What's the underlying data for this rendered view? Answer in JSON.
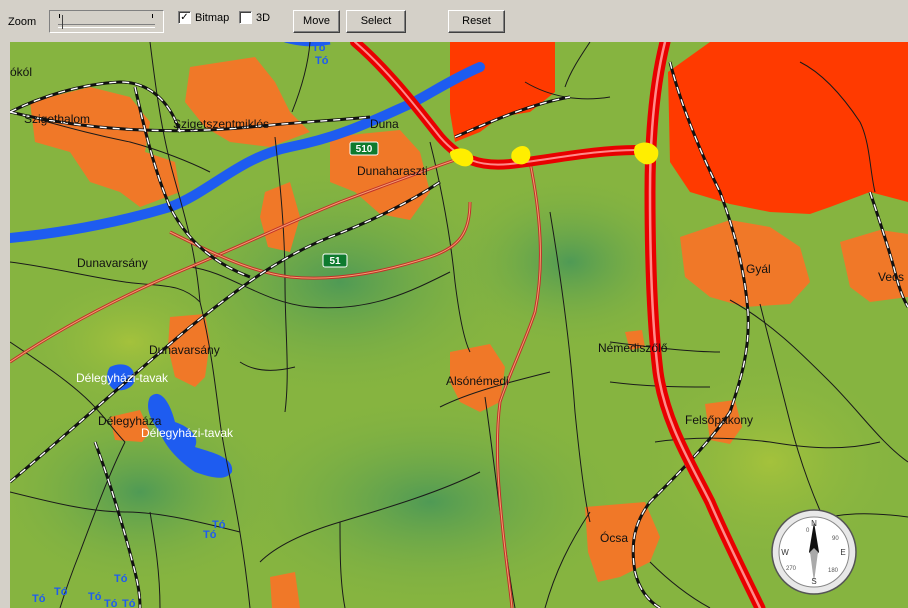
{
  "toolbar": {
    "zoom_label": "Zoom",
    "bitmap": {
      "label": "Bitmap",
      "checked": true
    },
    "threed": {
      "label": "3D",
      "checked": false
    },
    "move_label": "Move",
    "select_label": "Select",
    "reset_label": "Reset"
  },
  "map": {
    "colors": {
      "land": "#86b440",
      "land_dark": "#5f9e4c",
      "urban": "#f07828",
      "urban_dense": "#ff3a00",
      "water": "#1e5cf0",
      "motorway": "#e80000",
      "motorway_core": "#ff8a8a",
      "junction": "#ffee00"
    },
    "labels": {
      "okol": "ókól",
      "szigethalom": "Szigethalom",
      "szigetszentmiklos": "Szigetszentmiklós",
      "duna": "Duna",
      "dunaharaszti": "Dunaharaszti",
      "dunavarsany": "Dunavarsány",
      "dunavarsany2": "Dunavarsány",
      "delegyhazi_tavak_1": "Délegyházi-tavak",
      "delegyhaza": "Délegyháza",
      "delegyhazi_tavak_2": "Délegyházi-tavak",
      "alsonemedi": "Alsónémedi",
      "nemediszolo": "Némediszőlő",
      "felsopakony": "Felsőpakony",
      "gyal": "Gyál",
      "vecses": "Vecs",
      "ocsa": "Ócsa",
      "to_1": "Tó",
      "to_2": "Tó",
      "to_3": "Tó",
      "to_4": "Tó",
      "to_5": "Tó",
      "to_6": "Tó",
      "to_7": "Tó",
      "to_8": "Tó",
      "to_9": "Tó",
      "to_10": "Tó"
    },
    "shields": {
      "road_510": "510",
      "road_51": "51"
    },
    "compass": {
      "n": "N",
      "e": "E",
      "s": "S",
      "w": "W",
      "ticks": [
        "0",
        "90",
        "180",
        "270"
      ]
    }
  }
}
